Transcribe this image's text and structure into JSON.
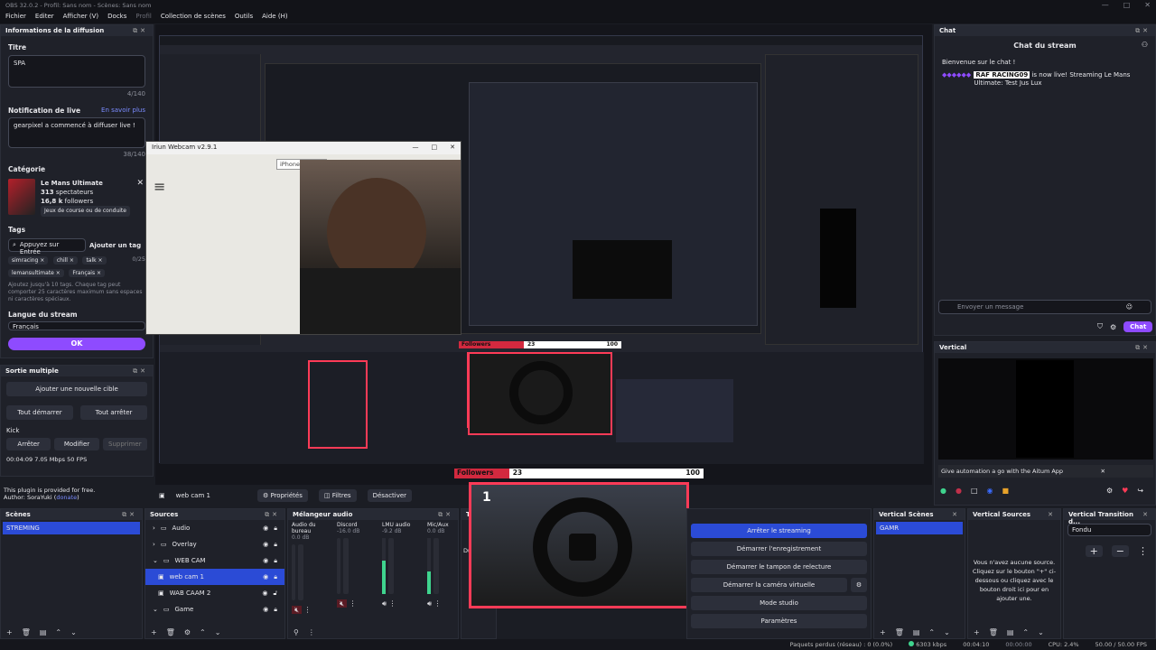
{
  "window": {
    "title": "OBS 32.0.2 - Profil: Sans nom - Scènes: Sans nom",
    "controls": [
      "—",
      "□",
      "✕"
    ]
  },
  "menu": [
    "Fichier",
    "Editer",
    "Afficher (V)",
    "Docks",
    "Profil",
    "Collection de scènes",
    "Outils",
    "Aide (H)"
  ],
  "stream_info": {
    "header": "Informations de la diffusion",
    "title_label": "Titre",
    "title_value": "SPA",
    "title_count": "4/140",
    "notif_label": "Notification de live",
    "notif_link": "En savoir plus",
    "notif_value": "gearpixel a commencé à diffuser live !",
    "notif_count": "38/140",
    "category_label": "Catégorie",
    "game_name": "Le Mans Ultimate",
    "viewers_num": "313",
    "viewers_txt": "spectateurs",
    "followers_num": "16,8 k",
    "followers_txt": "followers",
    "genre_tag": "Jeux de course ou de conduite",
    "tags_label": "Tags",
    "tag_placeholder": "Appuyez sur Entrée",
    "add_tag": "Ajouter un tag",
    "tag_count": "0/25",
    "tags": [
      "simracing ×",
      "chill ×",
      "talk ×",
      "lemansultimate ×",
      "Français ×"
    ],
    "tags_help": "Ajoutez jusqu'à 10 tags. Chaque tag peut comporter 25 caractères maximum sans espaces ni caractères spéciaux.",
    "lang_label": "Langue du stream",
    "lang_value": "Français",
    "ok": "OK"
  },
  "multi_output": {
    "header": "Sortie multiple",
    "add_target": "Ajouter une nouvelle cible",
    "start_all": "Tout démarrer",
    "stop_all": "Tout arrêter",
    "target": "Kick",
    "stop": "Arrêter",
    "edit": "Modifier",
    "delete": "Supprimer",
    "stats": "00:04:09  7.05 Mbps  50 FPS",
    "plugin_note": "This plugin is provided for free.",
    "author_prefix": "Author: SoraYuki (",
    "author_link": "donate",
    "author_suffix": ")"
  },
  "webcam_window": {
    "title": "Iriun Webcam v2.9.1",
    "device": "iPhone [Wi-Fi]",
    "controls": [
      "—",
      "□",
      "✕"
    ],
    "menu_icon": "≡"
  },
  "nested": {
    "title": "Iriun Webcam v2.9.1",
    "stats": "00:04:09  7.05 Mbps  50 FPS"
  },
  "followers_bar": {
    "label": "Followers",
    "current": "23",
    "goal": "100"
  },
  "source_bar": {
    "source": "web cam 1",
    "props": "Propriétés",
    "filters": "Filtres",
    "deactivate": "Désactiver"
  },
  "scenes": {
    "header": "Scènes",
    "items": [
      "STREMING"
    ]
  },
  "sources": {
    "header": "Sources",
    "items": [
      {
        "name": "Audio",
        "kind": "group"
      },
      {
        "name": "Overlay",
        "kind": "group"
      },
      {
        "name": "WEB CAM",
        "kind": "group"
      },
      {
        "name": "web cam 1",
        "kind": "item",
        "selected": true
      },
      {
        "name": "WAB CAAM 2",
        "kind": "item"
      },
      {
        "name": "Game",
        "kind": "group"
      }
    ]
  },
  "mixer": {
    "header": "Mélangeur audio",
    "channels": [
      {
        "name": "Audio du bureau",
        "db": "0.0 dB"
      },
      {
        "name": "Discord",
        "db": "-16.0 dB"
      },
      {
        "name": "LMU audio",
        "db": "-9.2 dB"
      },
      {
        "name": "Mic/Aux",
        "db": "0.0 dB"
      }
    ]
  },
  "controls": {
    "items": [
      "Arrêter le streaming",
      "Démarrer l'enregistrement",
      "Démarrer le tampon de relecture",
      "Démarrer la caméra virtuelle",
      "Mode studio",
      "Paramètres"
    ],
    "partial_tr": "Tr",
    "partial_du": "Du"
  },
  "vertical_scenes": {
    "header": "Vertical Scènes",
    "items": [
      "GAMR"
    ]
  },
  "vertical_sources": {
    "header": "Vertical Sources",
    "empty": "Vous n'avez aucune source. Cliquez sur le bouton \"+\" ci-dessous ou cliquez avec le bouton droit ici pour en ajouter une."
  },
  "vertical_transition": {
    "header": "Vertical Transition d...",
    "value": "Fondu"
  },
  "chat": {
    "dock_header": "Chat",
    "title": "Chat du stream",
    "welcome": "Bienvenue sur le chat !",
    "msg_user": "RAF RACING09",
    "msg_text": "Ultimate: Test Jus Lux",
    "msg_text2": "is now live! Streaming Le Mans",
    "placeholder": "Envoyer un message",
    "send": "Chat"
  },
  "vertical": {
    "header": "Vertical",
    "banner": "Give automation a go with the Aitum App",
    "close": "✕"
  },
  "status": {
    "dropped": "Paquets perdus (réseau) : 0 (0.0%)",
    "kbps": "6303 kbps",
    "live": "00:04:10",
    "rec": "00:00:00",
    "cpu": "CPU: 2.4%",
    "fps": "50.00 / 50.00 FPS"
  },
  "colors": {
    "accent": "#8e4bff",
    "select": "#2b4bd6",
    "alert": "#ff3b57"
  }
}
